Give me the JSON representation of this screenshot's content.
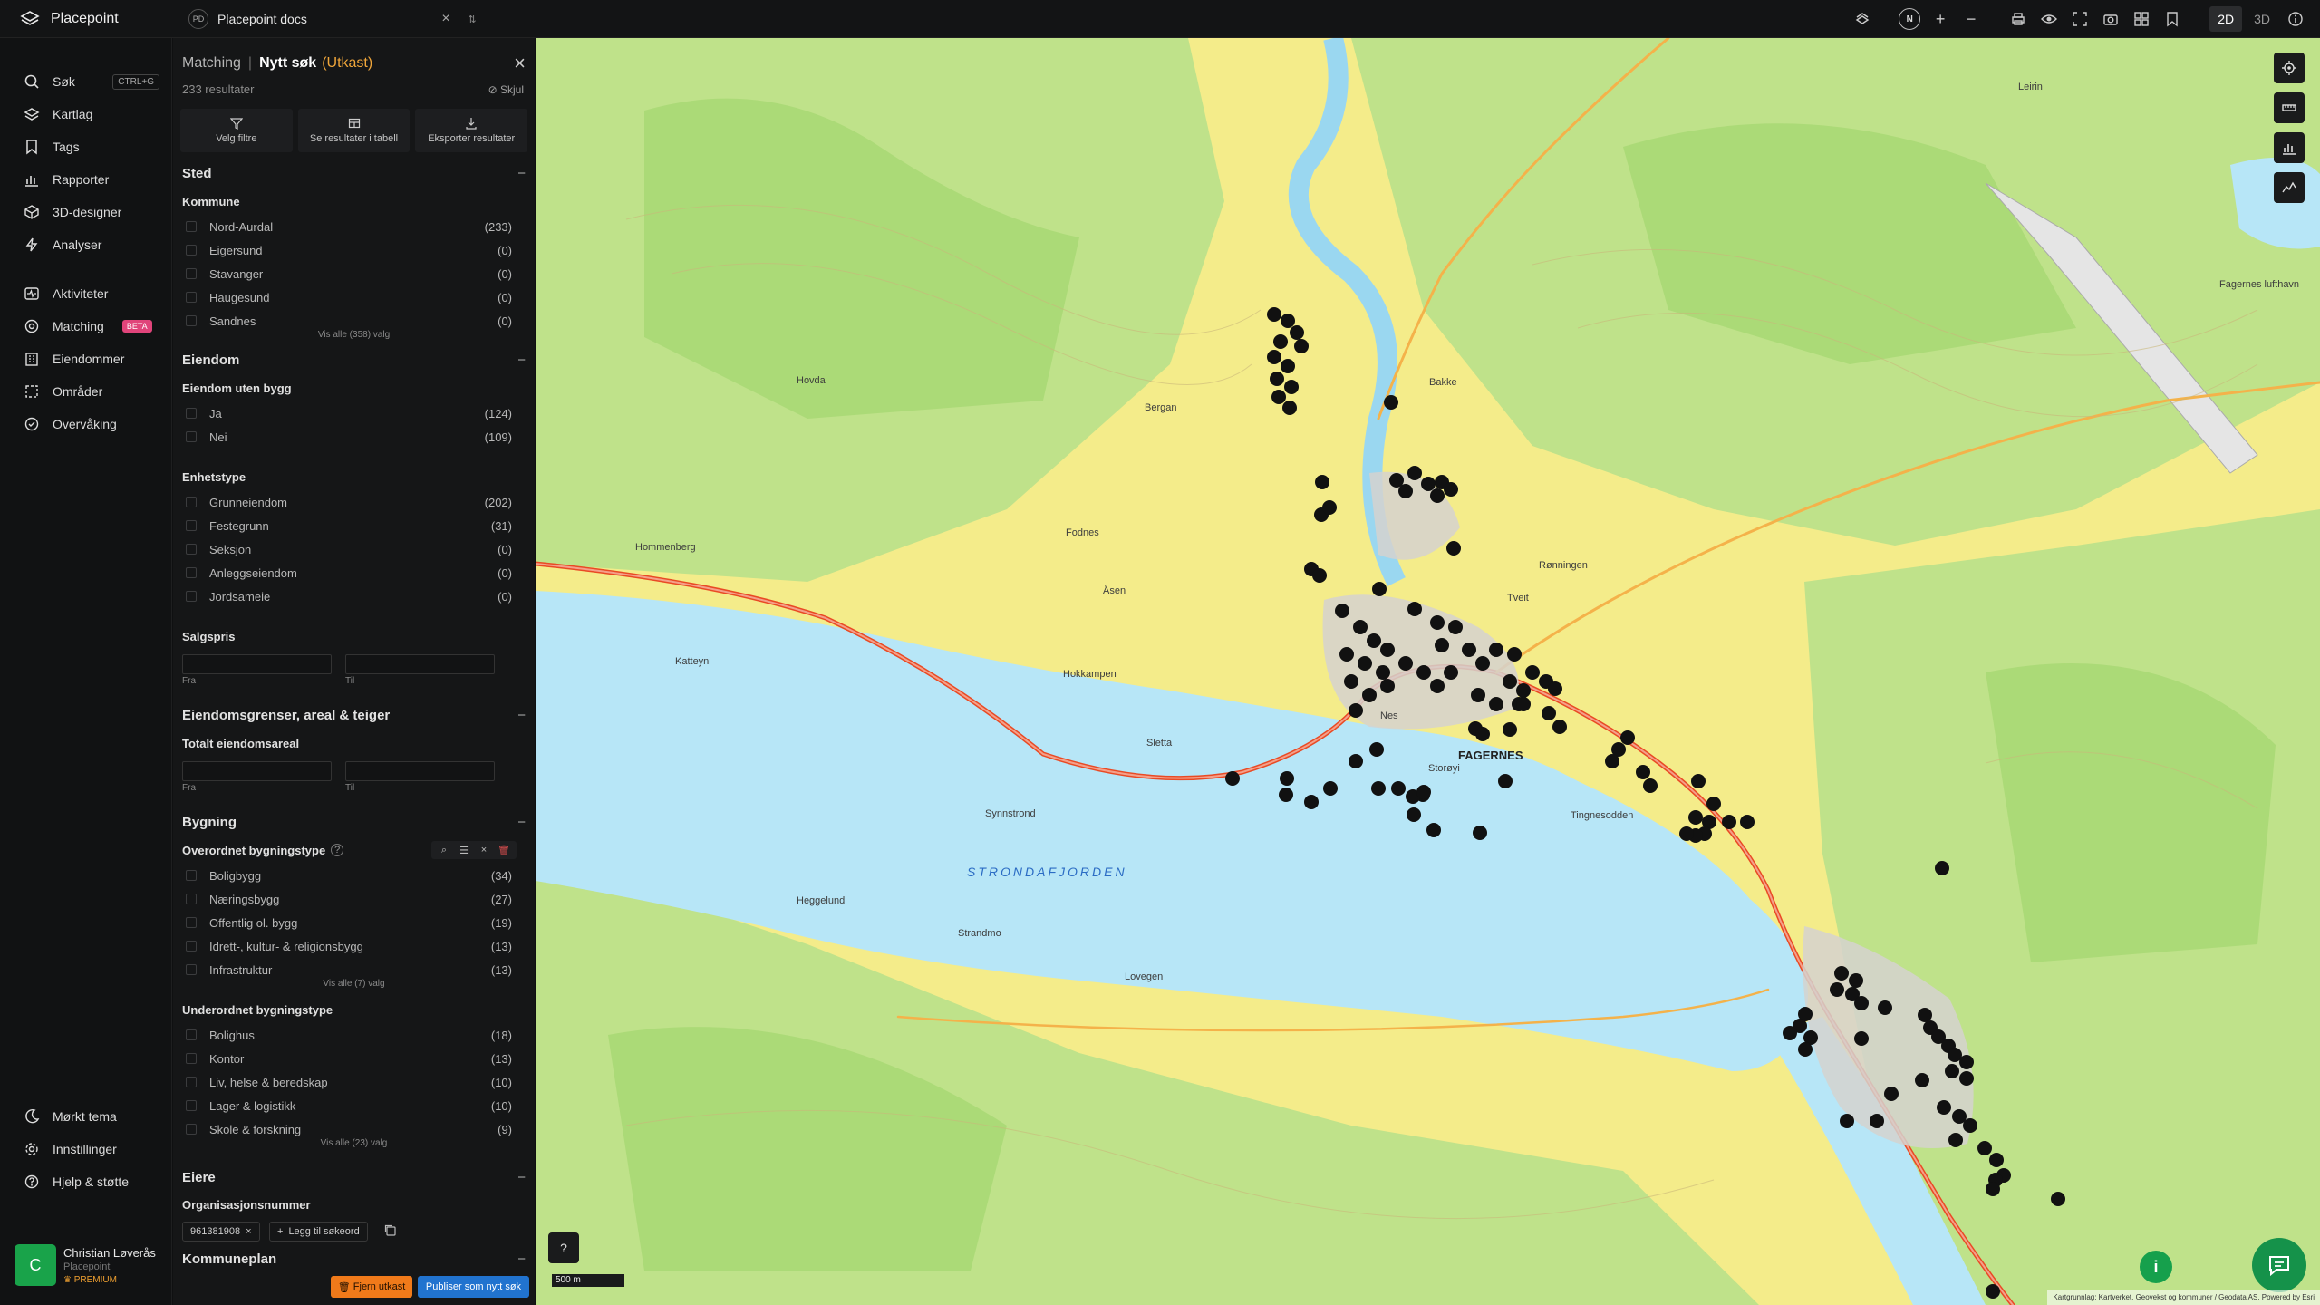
{
  "app": {
    "name": "Placepoint"
  },
  "doc_tab": {
    "initials": "PD",
    "name": "Placepoint docs"
  },
  "map_modes": [
    "2D",
    "3D"
  ],
  "compass": "N",
  "nav": {
    "items": [
      {
        "label": "Søk",
        "icon": "search-icon",
        "shortcut": "CTRL+G"
      },
      {
        "label": "Kartlag",
        "icon": "layers-icon"
      },
      {
        "label": "Tags",
        "icon": "bookmark-icon"
      },
      {
        "label": "Rapporter",
        "icon": "bar-chart-icon"
      },
      {
        "label": "3D-designer",
        "icon": "cube-icon"
      },
      {
        "label": "Analyser",
        "icon": "bolt-icon"
      },
      {
        "label": "Aktiviteter",
        "icon": "activity-icon"
      },
      {
        "label": "Matching",
        "icon": "target-icon",
        "badge": "BETA"
      },
      {
        "label": "Eiendommer",
        "icon": "building-icon"
      },
      {
        "label": "Områder",
        "icon": "area-icon"
      },
      {
        "label": "Overvåking",
        "icon": "monitor-icon"
      }
    ],
    "bottom_items": [
      {
        "label": "Mørkt tema",
        "icon": "moon-icon"
      },
      {
        "label": "Innstillinger",
        "icon": "gear-icon"
      },
      {
        "label": "Hjelp & støtte",
        "icon": "help-icon"
      }
    ],
    "user": {
      "initial": "C",
      "name": "Christian Løverås",
      "org": "Placepoint",
      "plan": "PREMIUM"
    }
  },
  "panel": {
    "breadcrumb": "Matching",
    "title": "Nytt søk",
    "status": "(Utkast)",
    "results": "233 resultater",
    "hide": "Skjul",
    "actions": [
      "Velg filtre",
      "Se resultater i tabell",
      "Eksporter resultater"
    ],
    "sted": {
      "title": "Sted",
      "kommune_label": "Kommune",
      "kommune": [
        {
          "label": "Nord-Aurdal",
          "count": "(233)"
        },
        {
          "label": "Eigersund",
          "count": "(0)"
        },
        {
          "label": "Stavanger",
          "count": "(0)"
        },
        {
          "label": "Haugesund",
          "count": "(0)"
        },
        {
          "label": "Sandnes",
          "count": "(0)"
        }
      ],
      "more": "Vis alle (358) valg"
    },
    "eiendom": {
      "title": "Eiendom",
      "uten_bygg_label": "Eiendom uten bygg",
      "uten_bygg": [
        {
          "label": "Ja",
          "count": "(124)"
        },
        {
          "label": "Nei",
          "count": "(109)"
        }
      ],
      "enhetstype_label": "Enhetstype",
      "enhetstype": [
        {
          "label": "Grunneiendom",
          "count": "(202)"
        },
        {
          "label": "Festegrunn",
          "count": "(31)"
        },
        {
          "label": "Seksjon",
          "count": "(0)"
        },
        {
          "label": "Anleggseiendom",
          "count": "(0)"
        },
        {
          "label": "Jordsameie",
          "count": "(0)"
        }
      ],
      "salgspris_label": "Salgspris",
      "from": "Fra",
      "to": "Til"
    },
    "grenser": {
      "title": "Eiendomsgrenser, areal & teiger",
      "areal_label": "Totalt eiendomsareal",
      "from": "Fra",
      "to": "Til"
    },
    "bygning": {
      "title": "Bygning",
      "overordnet_label": "Overordnet bygningstype",
      "overordnet": [
        {
          "label": "Boligbygg",
          "count": "(34)"
        },
        {
          "label": "Næringsbygg",
          "count": "(27)"
        },
        {
          "label": "Offentlig ol. bygg",
          "count": "(19)"
        },
        {
          "label": "Idrett-, kultur- & religionsbygg",
          "count": "(13)"
        },
        {
          "label": "Infrastruktur",
          "count": "(13)"
        }
      ],
      "overordnet_more": "Vis alle (7) valg",
      "underordnet_label": "Underordnet bygningstype",
      "underordnet": [
        {
          "label": "Bolighus",
          "count": "(18)"
        },
        {
          "label": "Kontor",
          "count": "(13)"
        },
        {
          "label": "Liv, helse & beredskap",
          "count": "(10)"
        },
        {
          "label": "Lager & logistikk",
          "count": "(10)"
        },
        {
          "label": "Skole & forskning",
          "count": "(9)"
        }
      ],
      "underordnet_more": "Vis alle (23) valg"
    },
    "eiere": {
      "title": "Eiere",
      "org_label": "Organisasjonsnummer",
      "org_chip": "961381908",
      "add_label": "Legg til søkeord"
    },
    "kommuneplan": {
      "title": "Kommuneplan"
    },
    "remove_draft": "Fjern utkast",
    "publish": "Publiser som nytt søk"
  },
  "map": {
    "labels": [
      "FAGERNES",
      "STRONDAFJORDEN",
      "Leirin",
      "Fagernes lufthavn",
      "Tingnesodden",
      "Strandmo",
      "Lovegen",
      "Synnstrond",
      "Storøyi",
      "Nes",
      "Tveit",
      "Rønningen",
      "Bergan",
      "Fodnes",
      "Heggelund",
      "Hovda",
      "Katteyni",
      "Hommenberg",
      "Sletta",
      "Hokkampen",
      "Bakke",
      "Åsen"
    ],
    "scale": "500 m",
    "attribution": "Kartgrunnlag: Kartverket, Geovekst og kommuner / Geodata AS. Powered by Esri"
  }
}
